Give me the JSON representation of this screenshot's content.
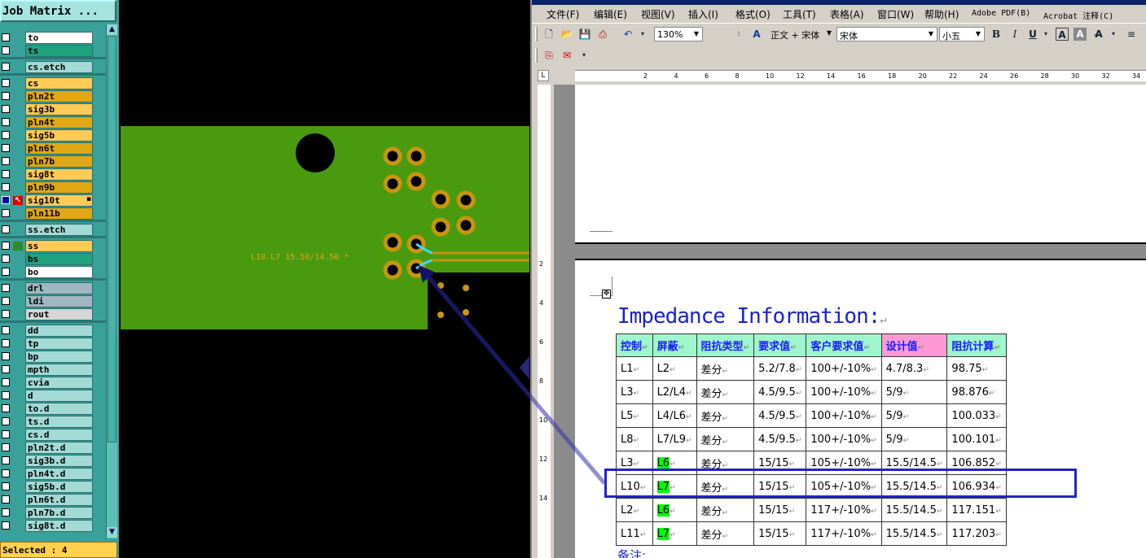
{
  "job_matrix": {
    "title": "Job Matrix ...",
    "status": "Selected : 4",
    "layers": [
      {
        "name": "to",
        "color": "#ffffff"
      },
      {
        "name": "ts",
        "color": "#1fa37f"
      },
      {
        "name": "cs.etch",
        "color": "#a3dad6"
      },
      {
        "name": "cs",
        "color": "#ffcb57"
      },
      {
        "name": "pln2t",
        "color": "#e0a815"
      },
      {
        "name": "sig3b",
        "color": "#ffcb57"
      },
      {
        "name": "pln4t",
        "color": "#e0a815"
      },
      {
        "name": "sig5b",
        "color": "#ffcb57"
      },
      {
        "name": "pln6t",
        "color": "#e0a815"
      },
      {
        "name": "pln7b",
        "color": "#e0a815"
      },
      {
        "name": "sig8t",
        "color": "#ffcb57"
      },
      {
        "name": "pln9b",
        "color": "#e0a815"
      },
      {
        "name": "sig10t",
        "color": "#ffcb57"
      },
      {
        "name": "pln11b",
        "color": "#e0a815"
      },
      {
        "name": "ss.etch",
        "color": "#a3dad6"
      },
      {
        "name": "ss",
        "color": "#ffcb57"
      },
      {
        "name": "bs",
        "color": "#1fa37f"
      },
      {
        "name": "bo",
        "color": "#ffffff"
      },
      {
        "name": "drl",
        "color": "#9fb7c0"
      },
      {
        "name": "ldi",
        "color": "#9fb7c0"
      },
      {
        "name": "rout",
        "color": "#d6d6d6"
      },
      {
        "name": "dd",
        "color": "#a3dad6"
      },
      {
        "name": "tp",
        "color": "#a3dad6"
      },
      {
        "name": "bp",
        "color": "#a3dad6"
      },
      {
        "name": "mpth",
        "color": "#a3dad6"
      },
      {
        "name": "cvia",
        "color": "#a3dad6"
      },
      {
        "name": "d",
        "color": "#a3dad6"
      },
      {
        "name": "to.d",
        "color": "#a3dad6"
      },
      {
        "name": "ts.d",
        "color": "#a3dad6"
      },
      {
        "name": "cs.d",
        "color": "#a3dad6"
      },
      {
        "name": "pln2t.d",
        "color": "#a3dad6"
      },
      {
        "name": "sig3b.d",
        "color": "#a3dad6"
      },
      {
        "name": "pln4t.d",
        "color": "#a3dad6"
      },
      {
        "name": "sig5b.d",
        "color": "#a3dad6"
      },
      {
        "name": "pln6t.d",
        "color": "#a3dad6"
      },
      {
        "name": "pln7b.d",
        "color": "#a3dad6"
      },
      {
        "name": "sig8t.d",
        "color": "#a3dad6"
      }
    ]
  },
  "pcb": {
    "trace_label": "L10.L7 15.50/14.50 *",
    "board_color": "#4a9a10",
    "pad_color": "#c8960c"
  },
  "word": {
    "menu": [
      "文件(F)",
      "编辑(E)",
      "视图(V)",
      "插入(I)",
      "格式(O)",
      "工具(T)",
      "表格(A)",
      "窗口(W)",
      "帮助(H)",
      "Adobe PDF(B)",
      "Acrobat 注释(C)"
    ],
    "toolbar": {
      "zoom": "130%",
      "style": "正文 + 宋体",
      "font": "宋体",
      "size": "小五",
      "bold": "B",
      "italic": "I",
      "underline": "U"
    },
    "ruler_corner": "L",
    "ruler_ticks": [
      "2",
      "4",
      "6",
      "8",
      "10",
      "12",
      "14",
      "16",
      "18",
      "20",
      "22",
      "24",
      "26",
      "28",
      "30",
      "32",
      "34"
    ],
    "vruler_ticks": [
      "2",
      "4",
      "6",
      "8",
      "10",
      "12",
      "14"
    ],
    "doc": {
      "title": "Impedance Information:",
      "headers": [
        "控制",
        "屏蔽",
        "阻抗类型",
        "要求值",
        "客户要求值",
        "设计值",
        "阻抗计算"
      ],
      "rows": [
        [
          "L1",
          "L2",
          "差分",
          "5.2/7.8",
          "100+/-10%",
          "4.7/8.3",
          "98.75"
        ],
        [
          "L3",
          "L2/L4",
          "差分",
          "4.5/9.5",
          "100+/-10%",
          "5/9",
          "98.876"
        ],
        [
          "L5",
          "L4/L6",
          "差分",
          "4.5/9.5",
          "100+/-10%",
          "5/9",
          "100.033"
        ],
        [
          "L8",
          "L7/L9",
          "差分",
          "4.5/9.5",
          "100+/-10%",
          "5/9",
          "100.101"
        ],
        [
          "L3",
          "L6",
          "差分",
          "15/15",
          "105+/-10%",
          "15.5/14.5",
          "106.852"
        ],
        [
          "L10",
          "L7",
          "差分",
          "15/15",
          "105+/-10%",
          "15.5/14.5",
          "106.934"
        ],
        [
          "L2",
          "L6",
          "差分",
          "15/15",
          "117+/-10%",
          "15.5/14.5",
          "117.151"
        ],
        [
          "L11",
          "L7",
          "差分",
          "15/15",
          "117+/-10%",
          "15.5/14.5",
          "117.203"
        ]
      ],
      "highlighted_shield_rows": [
        4,
        5,
        6,
        7
      ],
      "selected_row": 5,
      "note": "备注:"
    }
  }
}
